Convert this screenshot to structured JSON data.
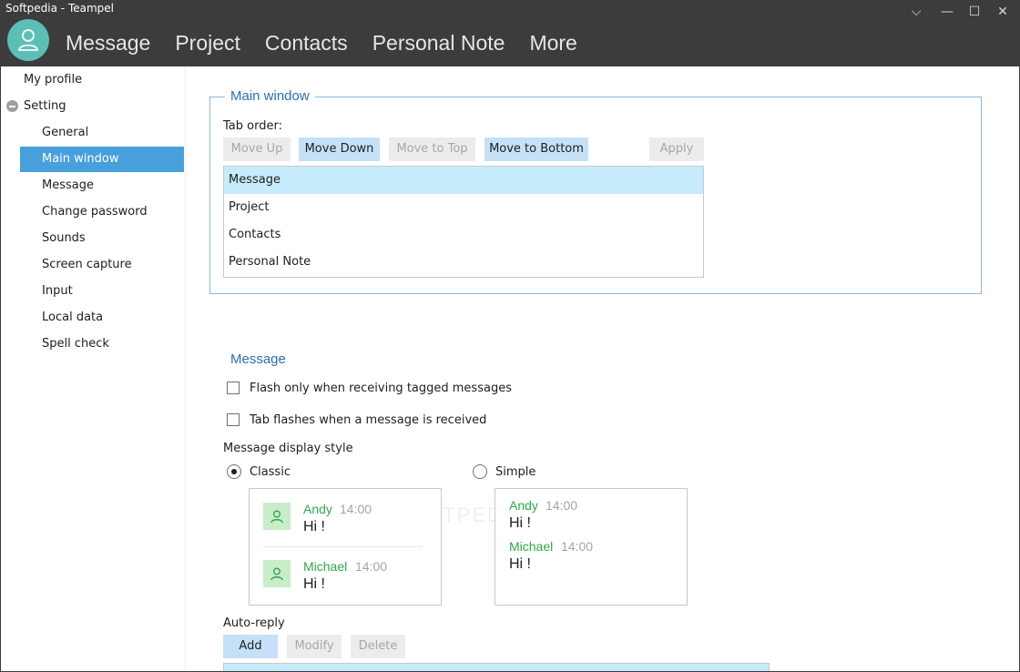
{
  "window": {
    "title": "Softpedia - Teampel",
    "controls": [
      "⌵",
      "—",
      "☐",
      "✕"
    ]
  },
  "nav": [
    "Message",
    "Project",
    "Contacts",
    "Personal Note",
    "More"
  ],
  "sidebar": {
    "my_profile": "My profile",
    "setting": "Setting",
    "items": [
      "General",
      "Main window",
      "Message",
      "Change password",
      "Sounds",
      "Screen capture",
      "Input",
      "Local data",
      "Spell check"
    ],
    "active_item": "Main window"
  },
  "main_window": {
    "legend": "Main window",
    "tab_order_label": "Tab order:",
    "buttons": {
      "move_up": "Move Up",
      "move_down": "Move Down",
      "move_top": "Move to Top",
      "move_bottom": "Move to Bottom",
      "apply": "Apply"
    },
    "tabs": [
      "Message",
      "Project",
      "Contacts",
      "Personal Note"
    ],
    "selected_tab": "Message"
  },
  "message": {
    "title": "Message",
    "flash_tagged": "Flash only when receiving tagged messages",
    "flash_received": "Tab flashes when a message is received",
    "display_style_label": "Message display style",
    "style_classic": "Classic",
    "style_simple": "Simple",
    "selected_style": "Classic",
    "preview": [
      {
        "sender": "Andy",
        "time": "14:00",
        "text": "Hi !"
      },
      {
        "sender": "Michael",
        "time": "14:00",
        "text": "Hi !"
      }
    ]
  },
  "auto_reply": {
    "label": "Auto-reply",
    "buttons": {
      "add": "Add",
      "modify": "Modify",
      "delete": "Delete"
    }
  },
  "watermark": "SOFTPEDIA",
  "colors": {
    "titlebar": "#3c3c3c",
    "accent": "#47a0dc",
    "legend": "#2a6fb8",
    "sender": "#2ea84a",
    "avatar": "#5bbfb5"
  }
}
